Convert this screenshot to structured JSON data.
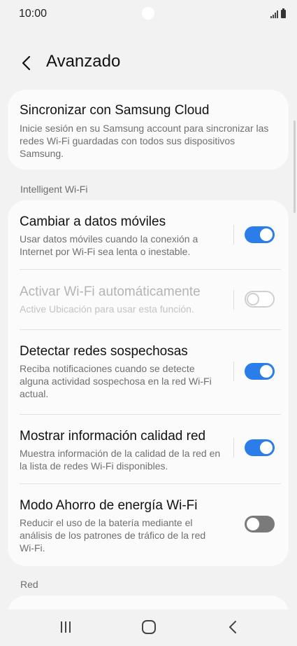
{
  "status_bar": {
    "time": "10:00"
  },
  "header": {
    "title": "Avanzado"
  },
  "cloud": {
    "title": "Sincronizar con Samsung Cloud",
    "description": "Inicie sesión en su Samsung account para sincronizar las redes Wi-Fi guardadas con todos sus dispositivos Samsung."
  },
  "sections": {
    "intelligent": "Intelligent Wi-Fi",
    "red": "Red"
  },
  "settings": [
    {
      "title": "Cambiar a datos móviles",
      "description": "Usar datos móviles cuando la conexión a Internet por Wi-Fi sea lenta o inestable.",
      "enabled": true,
      "disabled": false
    },
    {
      "title": "Activar Wi-Fi automáticamente",
      "description": "Active Ubicación para usar esta función.",
      "enabled": false,
      "disabled": true
    },
    {
      "title": "Detectar redes sospechosas",
      "description": "Reciba notificaciones cuando se detecte alguna actividad sospechosa en la red Wi-Fi actual.",
      "enabled": true,
      "disabled": false
    },
    {
      "title": "Mostrar información calidad red",
      "description": "Muestra información de la calidad de la red en la lista de redes Wi-Fi disponibles.",
      "enabled": true,
      "disabled": false
    },
    {
      "title": "Modo Ahorro de energía Wi-Fi",
      "description": "Reducir el uso de la batería mediante el análisis de los patrones de tráfico de la red Wi-Fi.",
      "enabled": false,
      "disabled": false
    }
  ],
  "icons": {
    "back": "chevron-left-icon",
    "recents": "recent-apps-icon",
    "home": "home-icon",
    "nav_back": "nav-back-icon"
  },
  "colors": {
    "accent": "#2b7de9",
    "background": "#f2f2f2",
    "card": "#fbfbfb"
  }
}
